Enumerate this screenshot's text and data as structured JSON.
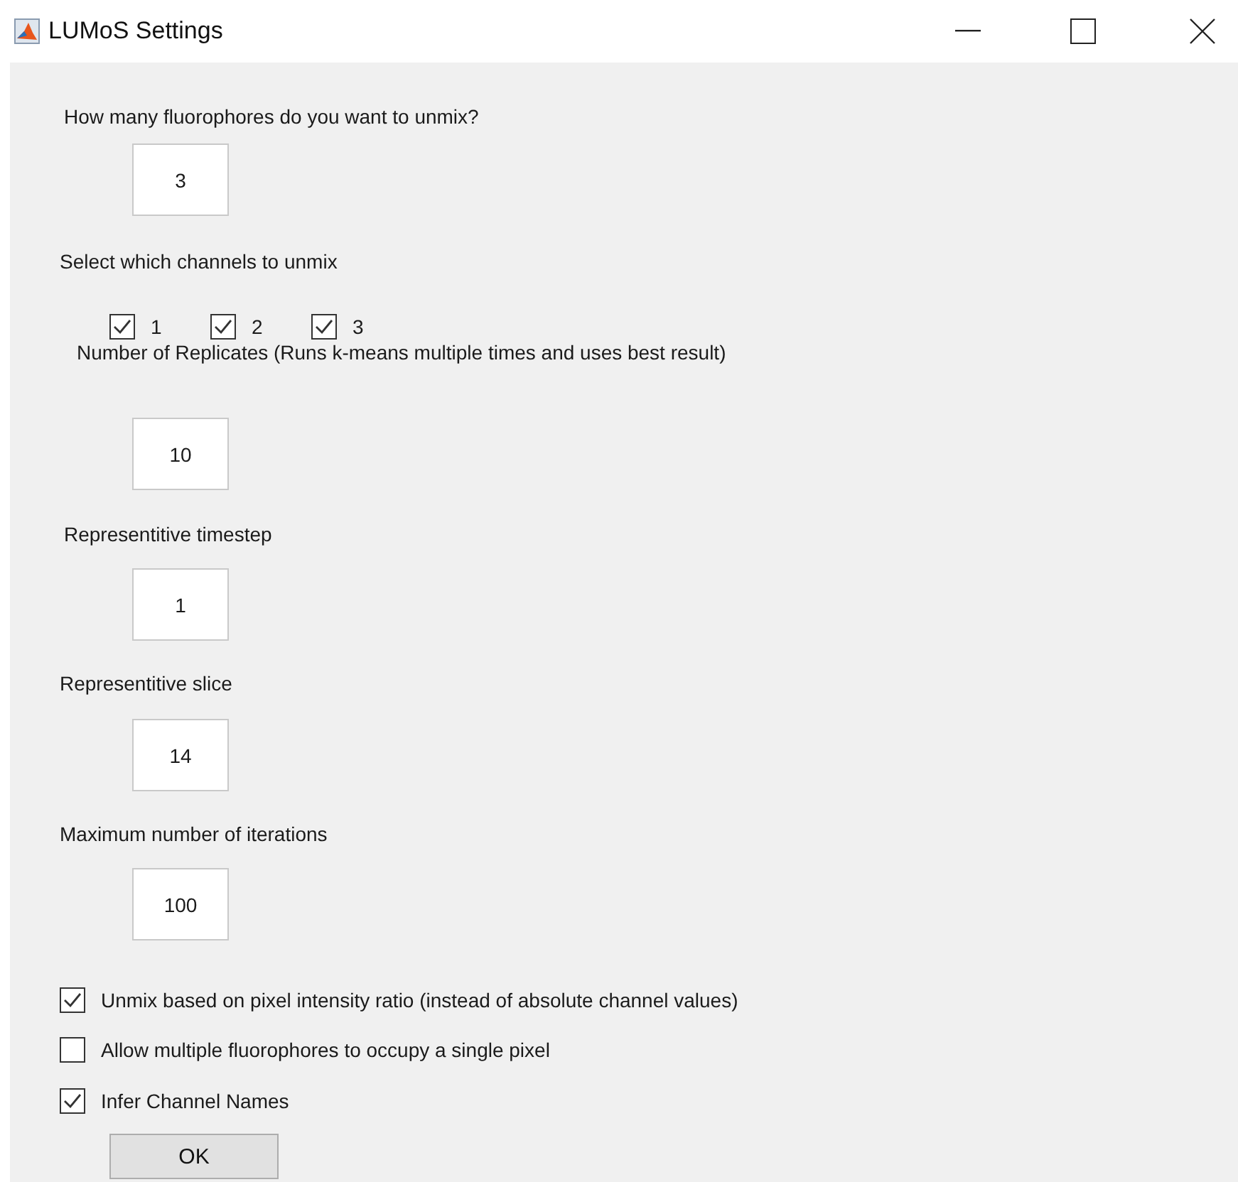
{
  "window": {
    "title": "LUMoS Settings"
  },
  "form": [
    {
      "kind": "label",
      "text": "How many fluorophores do you want to unmix?"
    },
    {
      "kind": "field",
      "value": "3"
    },
    {
      "kind": "label",
      "text": "Select which channels to unmix"
    },
    {
      "kind": "checkbox-group",
      "items": [
        {
          "label": "1",
          "checked": true
        },
        {
          "label": "2",
          "checked": true
        },
        {
          "label": "3",
          "checked": true
        }
      ]
    },
    {
      "kind": "label",
      "text": "Number of Replicates (Runs k-means multiple times and uses best result)"
    },
    {
      "kind": "field",
      "value": "10"
    },
    {
      "kind": "label",
      "text": "Representitive timestep"
    },
    {
      "kind": "field",
      "value": "1"
    },
    {
      "kind": "label",
      "text": "Representitive slice"
    },
    {
      "kind": "field",
      "value": "14"
    },
    {
      "kind": "label",
      "text": "Maximum number of iterations"
    },
    {
      "kind": "field",
      "value": "100"
    },
    {
      "kind": "checkbox",
      "label": "Unmix based on pixel intensity ratio (instead of absolute channel values)",
      "checked": true
    },
    {
      "kind": "checkbox",
      "label": "Allow multiple fluorophores to occupy a single pixel",
      "checked": false
    },
    {
      "kind": "checkbox",
      "label": "Infer Channel Names",
      "checked": true
    },
    {
      "kind": "button",
      "label": "OK"
    }
  ]
}
